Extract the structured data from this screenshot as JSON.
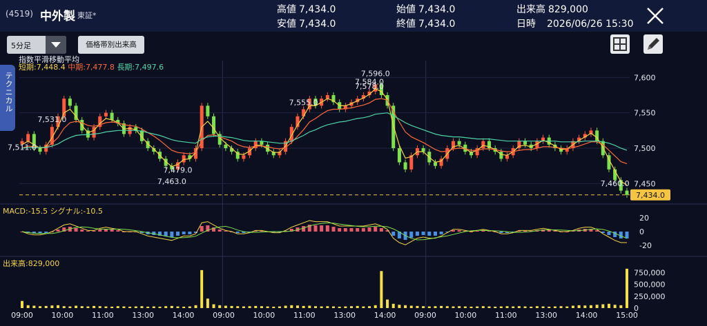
{
  "header": {
    "code": "(4519)",
    "name": "中外製",
    "market": "東証*",
    "high_label": "高値",
    "high": "7,434.0",
    "open_label": "始値",
    "open": "7,434.0",
    "volume_label": "出来高",
    "volume": "829,000",
    "low_label": "安値",
    "low": "7,434.0",
    "close_label": "終値",
    "close": "7,434.0",
    "datetime_label": "日時",
    "datetime": "2026/06/26 15:30"
  },
  "toolbar": {
    "interval": "5分足",
    "volume_by_price_button": "価格帯別出来高"
  },
  "side_tab": "テクニカル",
  "indicator": {
    "title": "指数平滑移動平均",
    "short_label": "短期:",
    "short": "7,448.4",
    "mid_label": "中期:",
    "mid": "7,477.8",
    "long_label": "長期:",
    "long": "7,497.6"
  },
  "macd": {
    "macd_label": "MACD:",
    "macd": "-15.5",
    "signal_label": "シグナル:",
    "signal": "-10.5"
  },
  "volume_panel": {
    "label": "出来高:",
    "value": "829,000"
  },
  "colors": {
    "up": "#ff5a3c",
    "down": "#7ee04c",
    "short": "#f5d547",
    "mid": "#ff6a3c",
    "long": "#4ed6a8",
    "current": "#f5c542"
  },
  "chart_data": {
    "type": "candlestick",
    "price_axis": {
      "ticks": [
        7600,
        7550,
        7500,
        7450
      ],
      "labels": [
        "7,600",
        "7,550",
        "7,500",
        "7,450"
      ],
      "ylim": [
        7425,
        7612
      ]
    },
    "current_price": 7434.0,
    "current_price_label": "7,434.0",
    "macd_axis": {
      "ticks": [
        20,
        0,
        -20
      ],
      "labels": [
        "20",
        "0",
        "-20"
      ]
    },
    "volume_axis": {
      "ticks": [
        750000,
        500000,
        250000,
        0
      ],
      "labels": [
        "750,000",
        "500,000",
        "250,000",
        "0"
      ]
    },
    "x_labels": [
      "09:00",
      "10:00",
      "11:00",
      "13:00",
      "14:00",
      "09:00",
      "10:00",
      "11:00",
      "13:00",
      "14:00",
      "09:00",
      "10:00",
      "11:00",
      "13:00",
      "14:00",
      "15:00"
    ],
    "annotations": [
      {
        "label": "7,578.0",
        "value": 7578.0,
        "pos": "above"
      },
      {
        "label": "7,511.0",
        "value": 7511.0,
        "pos": "below"
      },
      {
        "label": "7,555.0",
        "value": 7555.0,
        "pos": "above"
      },
      {
        "label": "7,463.0",
        "value": 7463.0,
        "pos": "below"
      },
      {
        "label": "7,584.0",
        "value": 7584.0,
        "pos": "above"
      },
      {
        "label": "7,479.0",
        "value": 7479.0,
        "pos": "below"
      },
      {
        "label": "7,596.0",
        "value": 7596.0,
        "pos": "above"
      },
      {
        "label": "7,460.0",
        "value": 7460.0,
        "pos": "below"
      },
      {
        "label": "7,531.0",
        "value": 7531.0,
        "pos": "above"
      }
    ],
    "close_path": [
      7510,
      7520,
      7500,
      7495,
      7505,
      7530,
      7545,
      7570,
      7560,
      7540,
      7525,
      7515,
      7530,
      7545,
      7550,
      7540,
      7535,
      7520,
      7530,
      7525,
      7510,
      7500,
      7495,
      7485,
      7475,
      7470,
      7480,
      7490,
      7485,
      7500,
      7560,
      7545,
      7520,
      7505,
      7500,
      7495,
      7485,
      7490,
      7500,
      7510,
      7505,
      7495,
      7490,
      7495,
      7510,
      7530,
      7545,
      7555,
      7570,
      7560,
      7570,
      7575,
      7565,
      7555,
      7560,
      7565,
      7570,
      7575,
      7580,
      7590,
      7575,
      7560,
      7500,
      7480,
      7470,
      7490,
      7500,
      7495,
      7480,
      7475,
      7485,
      7500,
      7510,
      7505,
      7495,
      7490,
      7500,
      7510,
      7500,
      7495,
      7485,
      7490,
      7500,
      7510,
      7505,
      7500,
      7510,
      7515,
      7505,
      7500,
      7495,
      7500,
      7510,
      7515,
      7520,
      7525,
      7510,
      7490,
      7470,
      7455,
      7440,
      7434
    ],
    "series": [
      {
        "name": "短期",
        "values": [
          7505,
          7510,
          7505,
          7500,
          7502,
          7515,
          7530,
          7550,
          7555,
          7545,
          7532,
          7522,
          7525,
          7535,
          7542,
          7540,
          7536,
          7527,
          7528,
          7526,
          7516,
          7506,
          7499,
          7490,
          7481,
          7474,
          7477,
          7484,
          7485,
          7494,
          7530,
          7538,
          7528,
          7515,
          7507,
          7500,
          7492,
          7491,
          7496,
          7504,
          7504,
          7499,
          7494,
          7494,
          7503,
          7518,
          7533,
          7545,
          7560,
          7560,
          7565,
          7570,
          7567,
          7560,
          7560,
          7563,
          7567,
          7571,
          7576,
          7584,
          7580,
          7569,
          7532,
          7504,
          7486,
          7488,
          7495,
          7495,
          7487,
          7480,
          7482,
          7492,
          7502,
          7504,
          7499,
          7494,
          7497,
          7504,
          7502,
          7498,
          7491,
          7490,
          7495,
          7503,
          7504,
          7502,
          7506,
          7511,
          7508,
          7503,
          7498,
          7499,
          7505,
          7511,
          7516,
          7521,
          7515,
          7501,
          7484,
          7468,
          7453,
          7448
        ]
      },
      {
        "name": "中期",
        "values": [
          7500,
          7503,
          7502,
          7501,
          7501,
          7507,
          7515,
          7528,
          7536,
          7538,
          7536,
          7532,
          7531,
          7533,
          7536,
          7537,
          7536,
          7533,
          7532,
          7531,
          7527,
          7522,
          7517,
          7511,
          7504,
          7497,
          7494,
          7493,
          7492,
          7494,
          7510,
          7518,
          7519,
          7516,
          7513,
          7510,
          7505,
          7502,
          7501,
          7503,
          7503,
          7502,
          7500,
          7499,
          7501,
          7508,
          7517,
          7526,
          7537,
          7542,
          7548,
          7553,
          7555,
          7555,
          7556,
          7557,
          7559,
          7561,
          7564,
          7569,
          7570,
          7568,
          7552,
          7537,
          7523,
          7516,
          7512,
          7508,
          7503,
          7498,
          7495,
          7496,
          7499,
          7500,
          7499,
          7497,
          7497,
          7499,
          7499,
          7498,
          7496,
          7495,
          7495,
          7497,
          7498,
          7498,
          7500,
          7502,
          7502,
          7501,
          7500,
          7499,
          7501,
          7503,
          7506,
          7509,
          7509,
          7505,
          7497,
          7489,
          7481,
          7478
        ]
      },
      {
        "name": "長期",
        "values": [
          7500,
          7501,
          7501,
          7501,
          7501,
          7503,
          7506,
          7511,
          7515,
          7518,
          7519,
          7519,
          7520,
          7521,
          7523,
          7524,
          7525,
          7525,
          7525,
          7525,
          7524,
          7522,
          7520,
          7518,
          7515,
          7512,
          7510,
          7509,
          7508,
          7507,
          7513,
          7516,
          7517,
          7517,
          7516,
          7515,
          7513,
          7511,
          7510,
          7510,
          7510,
          7509,
          7508,
          7507,
          7507,
          7510,
          7514,
          7518,
          7523,
          7526,
          7530,
          7533,
          7535,
          7537,
          7538,
          7540,
          7542,
          7543,
          7545,
          7548,
          7549,
          7550,
          7546,
          7541,
          7536,
          7532,
          7529,
          7526,
          7523,
          7520,
          7518,
          7517,
          7516,
          7516,
          7515,
          7514,
          7513,
          7513,
          7513,
          7512,
          7511,
          7510,
          7510,
          7510,
          7510,
          7510,
          7510,
          7510,
          7510,
          7510,
          7509,
          7509,
          7509,
          7509,
          7510,
          7510,
          7510,
          7509,
          7507,
          7504,
          7500,
          7497
        ]
      }
    ],
    "macd_hist": [
      0,
      -2,
      -3,
      -3,
      -2,
      0,
      3,
      6,
      7,
      5,
      3,
      1,
      1,
      3,
      4,
      3,
      2,
      0,
      0,
      0,
      -2,
      -4,
      -5,
      -6,
      -7,
      -8,
      -6,
      -4,
      -4,
      -2,
      8,
      9,
      6,
      3,
      1,
      0,
      -2,
      -2,
      -1,
      1,
      1,
      0,
      -1,
      -1,
      1,
      4,
      6,
      8,
      10,
      9,
      9,
      9,
      7,
      5,
      5,
      5,
      5,
      5,
      6,
      7,
      5,
      2,
      -6,
      -10,
      -12,
      -9,
      -6,
      -5,
      -6,
      -6,
      -4,
      -1,
      2,
      2,
      1,
      0,
      1,
      2,
      1,
      0,
      -2,
      -2,
      -1,
      1,
      1,
      1,
      2,
      3,
      2,
      1,
      0,
      0,
      1,
      3,
      4,
      4,
      2,
      -2,
      -5,
      -8,
      -10,
      -10
    ],
    "volume": [
      150000,
      60000,
      50000,
      40000,
      45000,
      55000,
      60000,
      40000,
      35000,
      50000,
      40000,
      35000,
      45000,
      40000,
      35000,
      30000,
      40000,
      35000,
      30000,
      35000,
      40000,
      30000,
      35000,
      30000,
      40000,
      45000,
      35000,
      30000,
      35000,
      60000,
      800000,
      200000,
      80000,
      60000,
      50000,
      45000,
      40000,
      35000,
      40000,
      45000,
      40000,
      35000,
      30000,
      35000,
      50000,
      60000,
      55000,
      45000,
      50000,
      40000,
      35000,
      40000,
      35000,
      30000,
      35000,
      40000,
      45000,
      35000,
      40000,
      60000,
      780000,
      180000,
      90000,
      70000,
      60000,
      50000,
      45000,
      40000,
      35000,
      40000,
      45000,
      40000,
      35000,
      40000,
      35000,
      30000,
      35000,
      40000,
      35000,
      30000,
      35000,
      40000,
      35000,
      40000,
      35000,
      30000,
      40000,
      35000,
      30000,
      35000,
      40000,
      35000,
      50000,
      60000,
      55000,
      60000,
      70000,
      80000,
      90000,
      70000,
      60000,
      829000
    ]
  }
}
